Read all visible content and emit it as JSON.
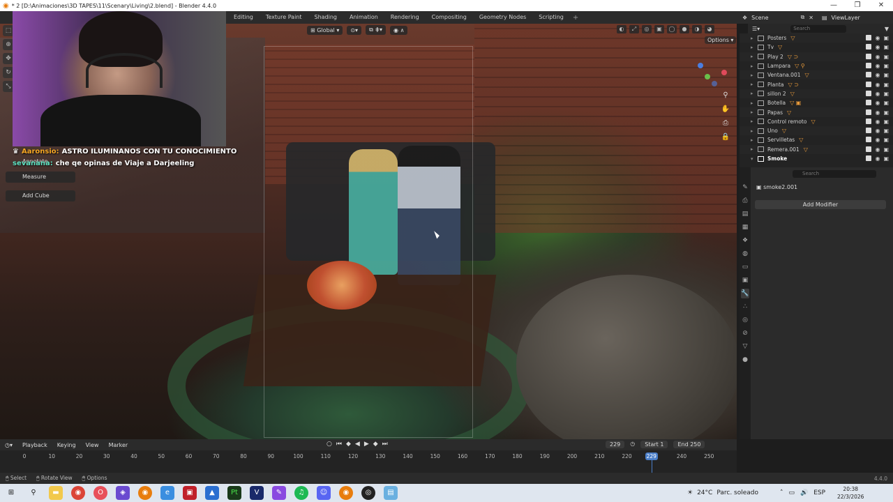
{
  "window": {
    "title": "* 2 [D:\\Animaciones\\3D TAPES\\11\\Scenary\\Living\\2.blend] - Blender 4.4.0",
    "controls": [
      "—",
      "❐",
      "✕"
    ]
  },
  "workspace_tabs": [
    "Editing",
    "Texture Paint",
    "Shading",
    "Animation",
    "Rendering",
    "Compositing",
    "Geometry Nodes",
    "Scripting"
  ],
  "viewport": {
    "orientation": "Global",
    "options_label": "Options"
  },
  "chat": [
    {
      "user": "Aaronsio:",
      "message": "ASTRO ILUMINANOS CON TU CONOCIMIENTO"
    },
    {
      "user": "sevanana:",
      "message": "che qe opinas de Viaje a Darjeeling"
    }
  ],
  "tool_menu": {
    "annotate": "Annotate",
    "measure": "Measure",
    "add_cube": "Add Cube"
  },
  "outliner": {
    "scene_label": "Scene",
    "view_layer_label": "ViewLayer",
    "search_placeholder": "Search",
    "items": [
      {
        "name": "Posters"
      },
      {
        "name": "Tv"
      },
      {
        "name": "Play 2"
      },
      {
        "name": "Lampara"
      },
      {
        "name": "Ventana.001"
      },
      {
        "name": "Planta"
      },
      {
        "name": "sillon 2"
      },
      {
        "name": "Botella"
      },
      {
        "name": "Papas"
      },
      {
        "name": "Control remoto"
      },
      {
        "name": "Uno"
      },
      {
        "name": "Servilletas"
      },
      {
        "name": "Remera.001"
      },
      {
        "name": "Smoke"
      }
    ]
  },
  "properties": {
    "search_placeholder": "Search",
    "object_name": "smoke2.001",
    "add_modifier": "Add Modifier"
  },
  "timeline": {
    "menus": [
      "Playback",
      "Keying",
      "View",
      "Marker"
    ],
    "current_frame": "229",
    "start_label": "Start",
    "start": "1",
    "end_label": "End",
    "end": "250",
    "ticks": [
      "0",
      "10",
      "20",
      "30",
      "40",
      "50",
      "60",
      "70",
      "80",
      "90",
      "100",
      "110",
      "120",
      "130",
      "140",
      "150",
      "160",
      "170",
      "180",
      "190",
      "200",
      "210",
      "220",
      "240",
      "250"
    ],
    "playhead": "229"
  },
  "statusbar": {
    "select": "Select",
    "rotate_view": "Rotate View",
    "options": "Options",
    "version": "4.4.0"
  },
  "taskbar": {
    "temperature": "24°C",
    "weather": "Parc. soleado",
    "language": "ESP",
    "time": "20:38",
    "date": "22/3/2026"
  }
}
